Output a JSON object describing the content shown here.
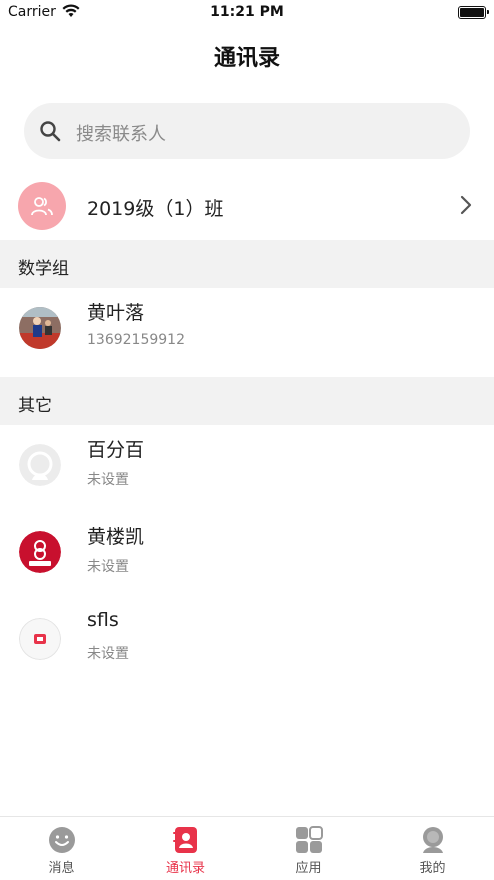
{
  "status_bar": {
    "carrier": "Carrier",
    "time": "11:21 PM"
  },
  "nav": {
    "title": "通讯录"
  },
  "search": {
    "placeholder": "搜索联系人"
  },
  "class_group": {
    "label": "2019级（1）班"
  },
  "sections": [
    {
      "title": "数学组",
      "contacts": [
        {
          "name": "黄叶落",
          "subtitle": "13692159912"
        }
      ]
    },
    {
      "title": "其它",
      "contacts": [
        {
          "name": "百分百",
          "subtitle": "未设置"
        },
        {
          "name": "黄楼凯",
          "subtitle": "未设置"
        },
        {
          "name": "sfls",
          "subtitle": "未设置"
        }
      ]
    }
  ],
  "tabbar": {
    "items": [
      {
        "label": "消息",
        "icon": "smile-face-icon"
      },
      {
        "label": "通讯录",
        "icon": "contacts-book-icon"
      },
      {
        "label": "应用",
        "icon": "apps-grid-icon"
      },
      {
        "label": "我的",
        "icon": "profile-icon"
      }
    ],
    "active_color": "#e8334a"
  },
  "colors": {
    "accent": "#e8334a",
    "class_avatar_bg": "#f7a6ad",
    "section_bg": "#f2f2f2"
  }
}
